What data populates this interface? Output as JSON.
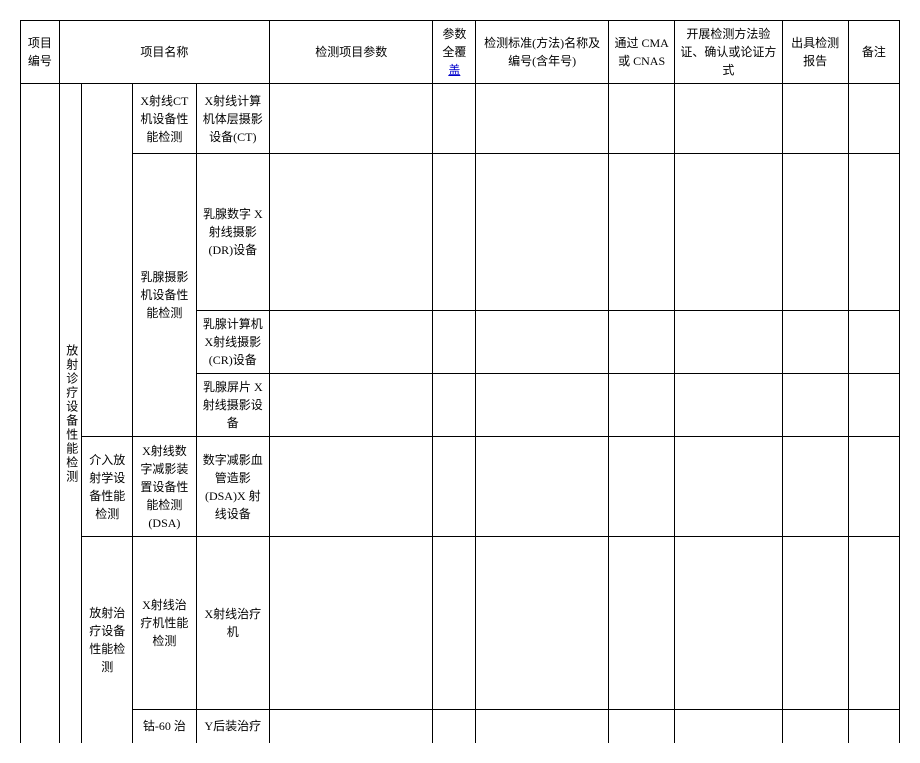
{
  "headers": {
    "project_id": "项目编号",
    "project_name": "项目名称",
    "test_param": "检测项目参数",
    "full_cover": "参数全覆盖",
    "full_cover_a": "参数全覆",
    "full_cover_b": "盖",
    "standard": "检测标准(方法)名称及编号(含年号)",
    "cma_cnas": "通过 CMA 或 CNAS",
    "verify_method": "开展检测方法验证、确认或论证方式",
    "report": "出具检测报告",
    "note": "备注"
  },
  "tree": {
    "l1": "放射诊疗设备性能检测",
    "branch_a": {
      "l2_continued": "",
      "l3_ct": "X射线CT机设备性能检测",
      "l4_ct": "X射线计算机体层摄影设备(CT)",
      "l3_mammo": "乳腺摄影机设备性能检测",
      "l4_mammo_dr": "乳腺数字 X 射线摄影(DR)设备",
      "l4_mammo_cr": "乳腺计算机 X射线摄影(CR)设备",
      "l4_mammo_film": "乳腺屏片 X射线摄影设备"
    },
    "branch_b": {
      "l2": "介入放射学设备性能检测",
      "l3_dsa": "X射线数字减影装置设备性能检测(DSA)",
      "l4_dsa": "数字减影血管造影(DSA)X 射线设备"
    },
    "branch_c": {
      "l2": "放射治疗设备性能检测",
      "l3_therapy": "X射线治疗机性能检测",
      "l4_therapy": "X射线治疗机",
      "l3_co60": "钴-60 治",
      "l4_co60": "Y后装治疗"
    }
  }
}
